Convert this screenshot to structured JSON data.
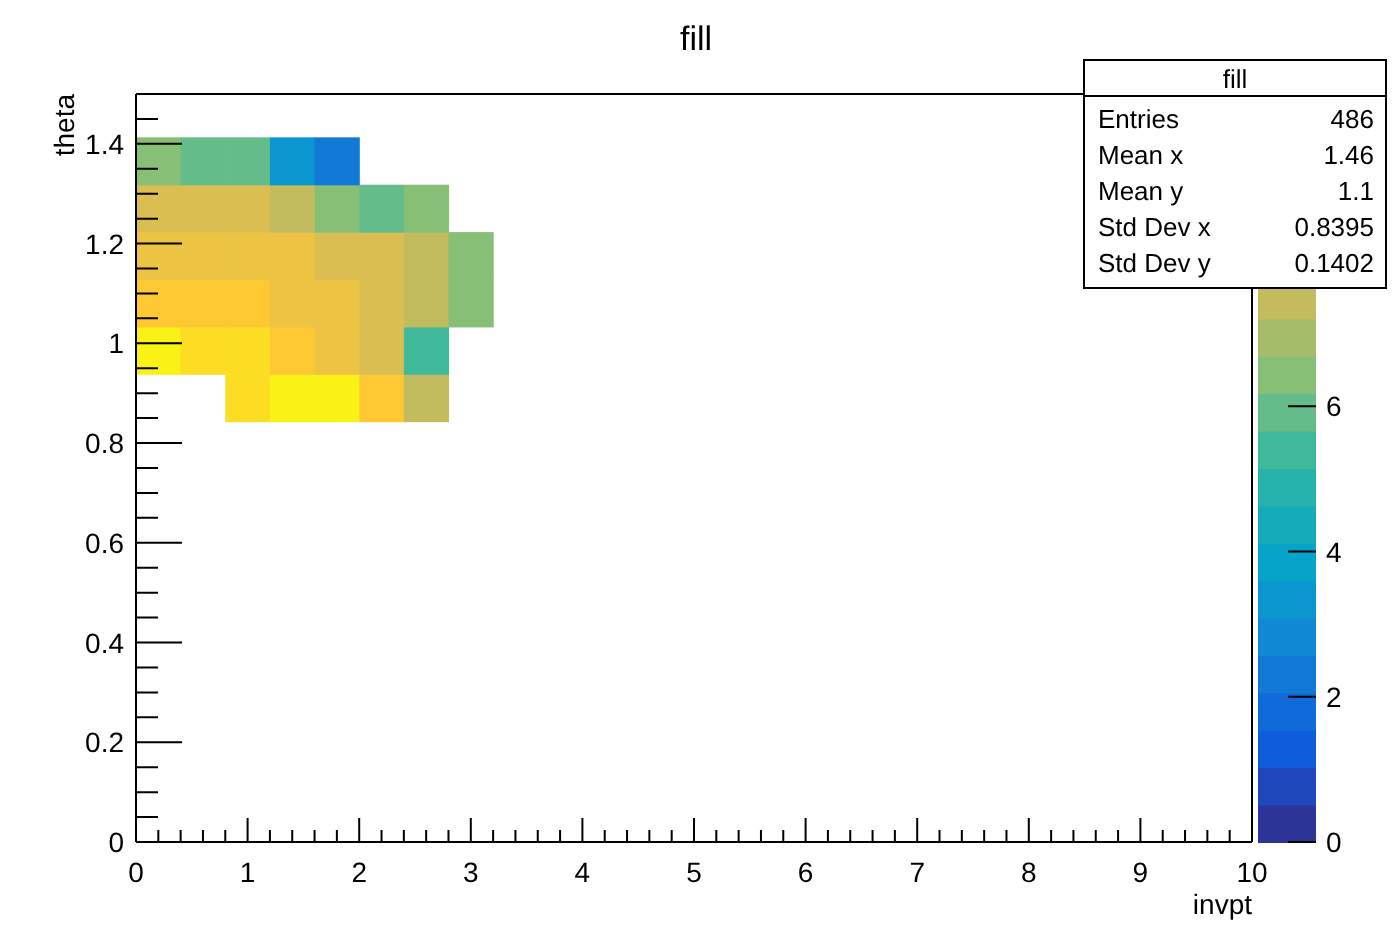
{
  "plot": {
    "title": "fill",
    "x_axis": {
      "title": "invpt",
      "tick_labels": [
        "0",
        "1",
        "2",
        "3",
        "4",
        "5",
        "6",
        "7",
        "8",
        "9",
        "10"
      ]
    },
    "y_axis": {
      "title": "theta",
      "tick_labels": [
        "1.4",
        "1.2",
        "1",
        "0.8",
        "0.6",
        "0.4",
        "0.2",
        "0"
      ]
    },
    "color_scale": {
      "tick_labels": [
        "6",
        "4",
        "2",
        "0"
      ]
    }
  },
  "stats": {
    "title": "fill",
    "rows": [
      {
        "label": "Entries",
        "value": "486"
      },
      {
        "label": "Mean x",
        "value": "1.46"
      },
      {
        "label": "Mean y",
        "value": "1.1"
      },
      {
        "label": "Std Dev x",
        "value": "0.8395"
      },
      {
        "label": "Std Dev y",
        "value": "0.1402"
      }
    ]
  }
}
